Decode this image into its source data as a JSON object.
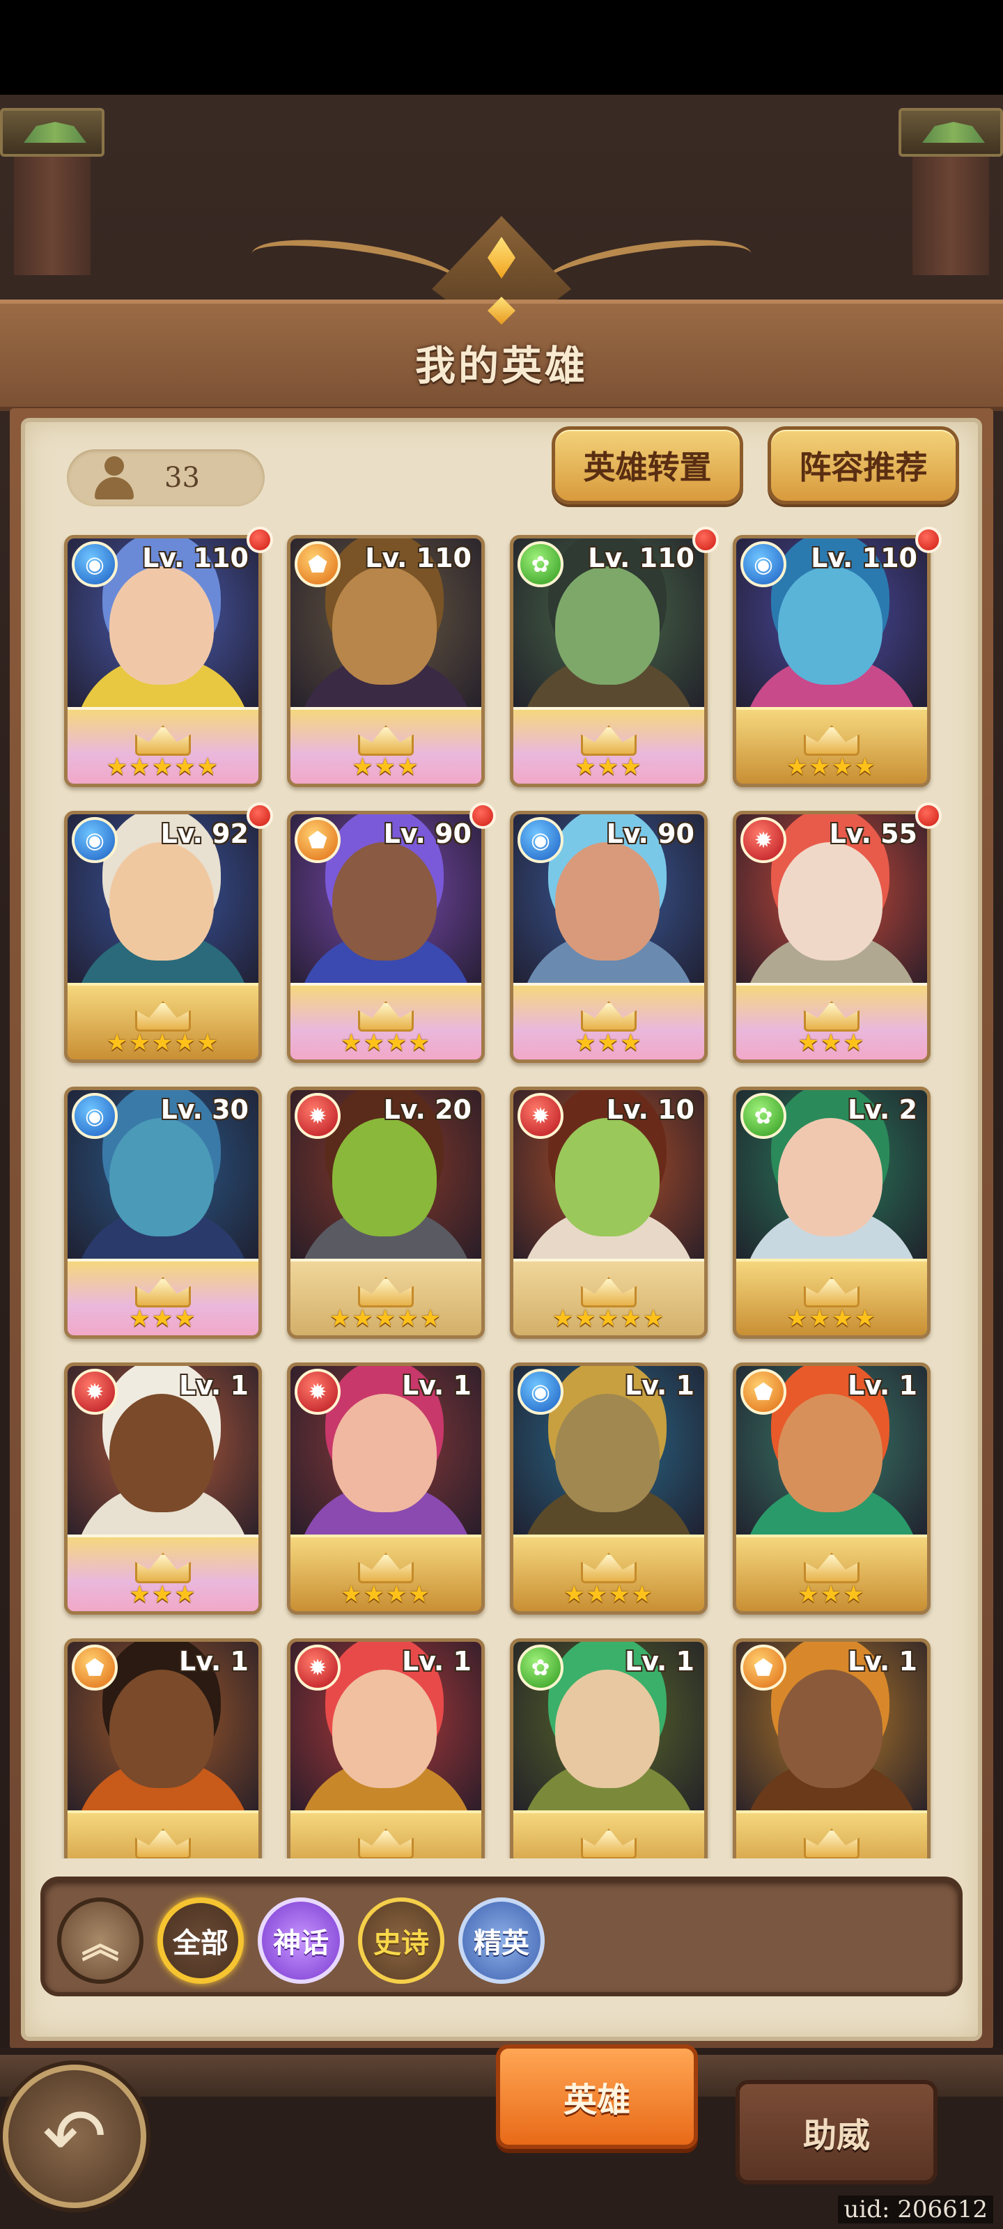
{
  "header": {
    "title": "我的英雄"
  },
  "toolbar": {
    "hero_count": "33",
    "transfer_label": "英雄转置",
    "lineup_label": "阵容推荐"
  },
  "heroes": [
    {
      "level": "Lv. 110",
      "faction": "water",
      "stars": "★★★★★",
      "base": "wing",
      "notify": true,
      "skin": "#f0c8a8",
      "bg": "#4a5cb0",
      "hair": "#6a8ad8",
      "cloth": "#e8c840"
    },
    {
      "level": "Lv. 110",
      "faction": "light",
      "stars": "★★★",
      "base": "wing",
      "notify": false,
      "skin": "#b8864a",
      "bg": "#6a5a42",
      "hair": "#7a5426",
      "cloth": "#3a2a44"
    },
    {
      "level": "Lv. 110",
      "faction": "nature",
      "stars": "★★★",
      "base": "wing",
      "notify": true,
      "skin": "#7ea86a",
      "bg": "#4a6a48",
      "hair": "#2e3a32",
      "cloth": "#5a4a30"
    },
    {
      "level": "Lv. 110",
      "faction": "water",
      "stars": "★★★★",
      "base": "gold",
      "notify": true,
      "skin": "#5ab4d8",
      "bg": "#4a4aa0",
      "hair": "#2a7ab0",
      "cloth": "#c84a8a"
    },
    {
      "level": "Lv. 92",
      "faction": "water",
      "stars": "★★★★★",
      "base": "gold",
      "notify": true,
      "skin": "#f0c8a0",
      "bg": "#3a56a0",
      "hair": "#e8e0d0",
      "cloth": "#2a6a7a"
    },
    {
      "level": "Lv. 90",
      "faction": "light",
      "stars": "★★★★",
      "base": "wing",
      "notify": true,
      "skin": "#8a5a42",
      "bg": "#7a4ab0",
      "hair": "#7a5ad8",
      "cloth": "#3a4ab0"
    },
    {
      "level": "Lv. 90",
      "faction": "water",
      "stars": "★★★",
      "base": "wing",
      "notify": false,
      "skin": "#d89a7a",
      "bg": "#3a5a9a",
      "hair": "#7ac8e8",
      "cloth": "#6a8ab0"
    },
    {
      "level": "Lv. 55",
      "faction": "fire",
      "stars": "★★★",
      "base": "wing",
      "notify": true,
      "skin": "#f0d8c8",
      "bg": "#c84a3a",
      "hair": "#e85a4a",
      "cloth": "#b0a890"
    },
    {
      "level": "Lv. 30",
      "faction": "water",
      "stars": "★★★",
      "base": "wing",
      "notify": false,
      "skin": "#4a9ab8",
      "bg": "#2a5a8a",
      "hair": "#3a7aa8",
      "cloth": "#2a3a6a"
    },
    {
      "level": "Lv. 20",
      "faction": "fire",
      "stars": "★★★★★",
      "base": "silver",
      "notify": false,
      "skin": "#8ab83a",
      "bg": "#8a3a2a",
      "hair": "#5a2a1a",
      "cloth": "#5a5a62"
    },
    {
      "level": "Lv. 10",
      "faction": "fire",
      "stars": "★★★★★",
      "base": "silver",
      "notify": false,
      "skin": "#9ac85a",
      "bg": "#b0502a",
      "hair": "#6a2a1a",
      "cloth": "#e8d8c8"
    },
    {
      "level": "Lv. 2",
      "faction": "nature",
      "stars": "★★★★",
      "base": "gold",
      "notify": false,
      "skin": "#f0c8b0",
      "bg": "#2a7a5a",
      "hair": "#2a8a5a",
      "cloth": "#c8d8e0"
    },
    {
      "level": "Lv. 1",
      "faction": "fire",
      "stars": "★★★",
      "base": "wing",
      "notify": false,
      "skin": "#7a4a2a",
      "bg": "#b05a3a",
      "hair": "#f0ebe0",
      "cloth": "#e8e0d0"
    },
    {
      "level": "Lv. 1",
      "faction": "fire",
      "stars": "★★★★",
      "base": "gold",
      "notify": false,
      "skin": "#f0b8a0",
      "bg": "#8a3a3a",
      "hair": "#c8386a",
      "cloth": "#8a4ab0"
    },
    {
      "level": "Lv. 1",
      "faction": "water",
      "stars": "★★★★",
      "base": "gold",
      "notify": false,
      "skin": "#a08850",
      "bg": "#2a6a8a",
      "hair": "#c8a040",
      "cloth": "#5a4a2a"
    },
    {
      "level": "Lv. 1",
      "faction": "light",
      "stars": "★★★",
      "base": "gold",
      "notify": false,
      "skin": "#d8905a",
      "bg": "#3a7a6a",
      "hair": "#e85a2a",
      "cloth": "#2a9a6a"
    },
    {
      "level": "Lv. 1",
      "faction": "light",
      "stars": "★★★",
      "base": "gold",
      "notify": false,
      "skin": "#7a4a2a",
      "bg": "#a05a2a",
      "hair": "#2a1a12",
      "cloth": "#c85a1a"
    },
    {
      "level": "Lv. 1",
      "faction": "fire",
      "stars": "★★★",
      "base": "gold",
      "notify": false,
      "skin": "#f0c0a0",
      "bg": "#b03a3a",
      "hair": "#e84a4a",
      "cloth": "#c8882a"
    },
    {
      "level": "Lv. 1",
      "faction": "nature",
      "stars": "★★★",
      "base": "gold",
      "notify": false,
      "skin": "#e8c8a0",
      "bg": "#5a6a2a",
      "hair": "#3ab06a",
      "cloth": "#7a8a3a"
    },
    {
      "level": "Lv. 1",
      "faction": "light",
      "stars": "★★★",
      "base": "gold",
      "notify": false,
      "skin": "#8a5a3a",
      "bg": "#b0782a",
      "hair": "#d8882a",
      "cloth": "#6a3a1a"
    }
  ],
  "filters": {
    "collapse_icon": "double-chevron-up-icon",
    "all_label": "全部",
    "myth_label": "神话",
    "epic_label": "史诗",
    "elite_label": "精英"
  },
  "tabs": {
    "heroes_label": "英雄",
    "support_label": "助威"
  },
  "footer": {
    "uid": "uid: 206612"
  },
  "colors": {
    "accent_gold": "#f5c430",
    "tab_active": "#e86a18",
    "notify_red": "#cf1c14"
  }
}
